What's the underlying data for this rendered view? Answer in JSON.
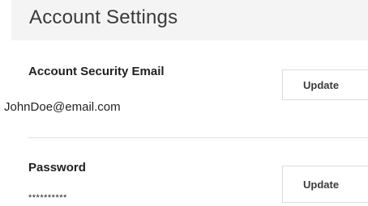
{
  "header": {
    "title": "Account Settings"
  },
  "email_section": {
    "label": "Account Security Email",
    "value": "JohnDoe@email.com",
    "button_label": "Update"
  },
  "password_section": {
    "label": "Password",
    "value": "**********",
    "button_label": "Update"
  }
}
